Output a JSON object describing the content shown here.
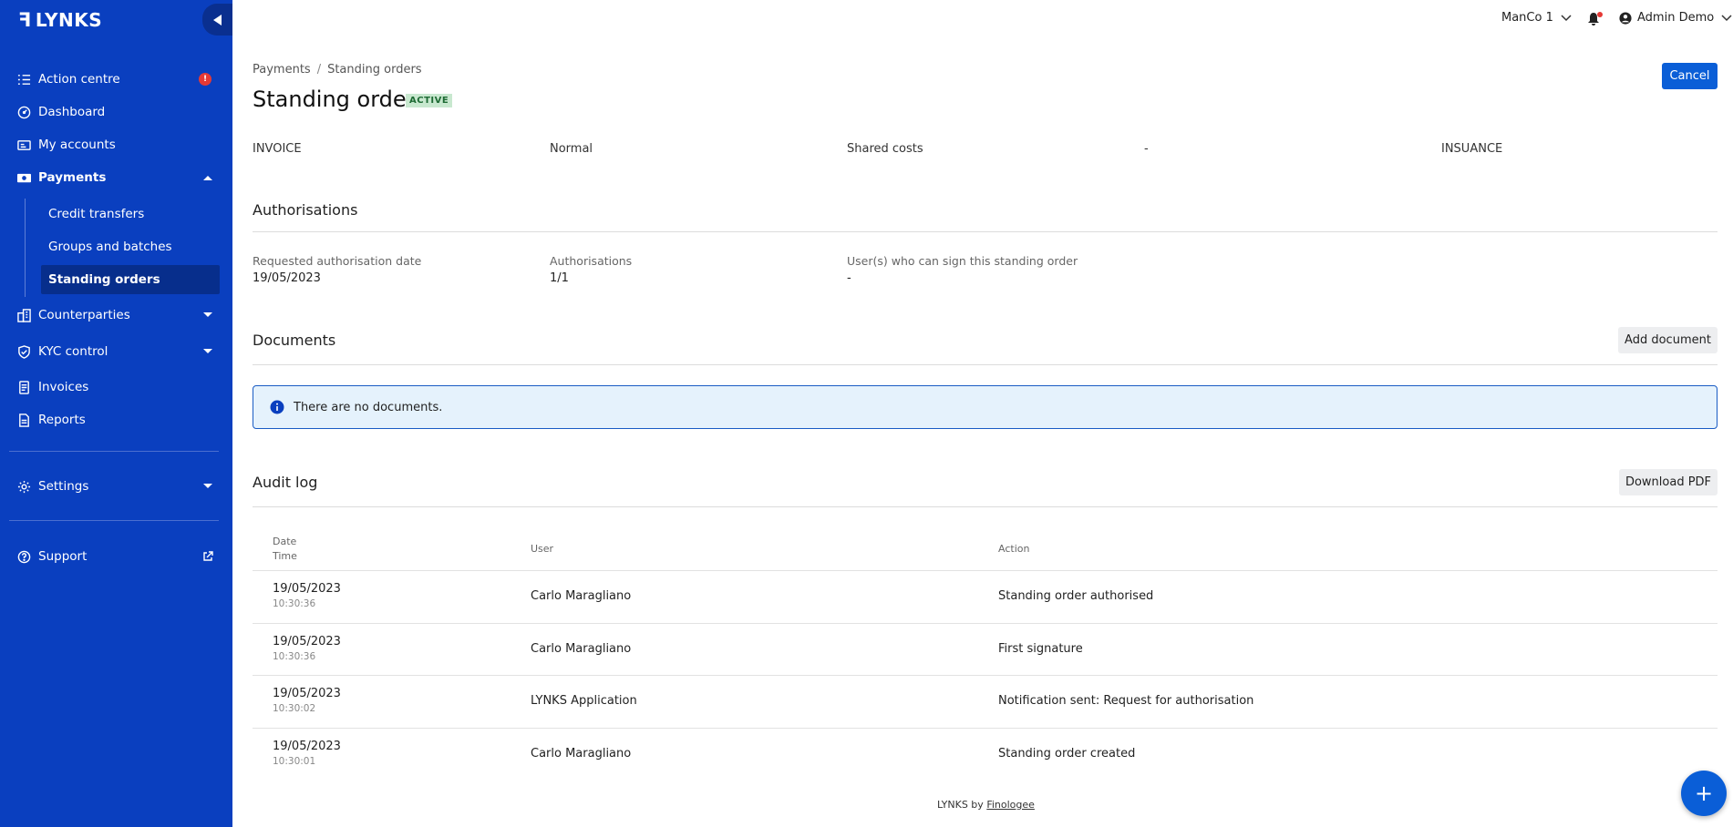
{
  "app": {
    "logo_text": "LYNKS",
    "logo_mark": "ꟻ"
  },
  "colors": {
    "sidebar": "#0a3fbf",
    "accent": "#0a5ed7",
    "alert": "#e53935",
    "active_badge_bg": "#c8e8cf"
  },
  "sidebar": {
    "items": [
      {
        "label": "Action centre",
        "icon": "checklist-icon",
        "badge": "!"
      },
      {
        "label": "Dashboard",
        "icon": "dashboard-icon"
      },
      {
        "label": "My accounts",
        "icon": "accounts-icon"
      },
      {
        "label": "Payments",
        "icon": "payments-icon"
      },
      {
        "label": "Counterparties",
        "icon": "counterparties-icon"
      },
      {
        "label": "KYC control",
        "icon": "shield-icon"
      },
      {
        "label": "Invoices",
        "icon": "invoice-icon"
      },
      {
        "label": "Reports",
        "icon": "report-icon"
      },
      {
        "label": "Settings",
        "icon": "gear-icon"
      },
      {
        "label": "Support",
        "icon": "help-icon"
      }
    ],
    "payments_sub": [
      "Credit transfers",
      "Groups and batches",
      "Standing orders"
    ]
  },
  "topbar": {
    "company": "ManCo 1",
    "user": "Admin Demo"
  },
  "breadcrumb": [
    "Payments",
    "Standing orders"
  ],
  "page": {
    "title": "Standing order",
    "status": "ACTIVE",
    "cancel_label": "Cancel"
  },
  "cut_row": [
    "INVOICE",
    "Normal",
    "Shared costs",
    "-",
    "INSUANCE"
  ],
  "authorisations": {
    "title": "Authorisations",
    "fields": [
      {
        "label": "Requested authorisation date",
        "value": "19/05/2023"
      },
      {
        "label": "Authorisations",
        "value": "1/1"
      },
      {
        "label": "User(s) who can sign this standing order",
        "value": "-"
      }
    ]
  },
  "documents": {
    "title": "Documents",
    "add_label": "Add document",
    "empty_text": "There are no documents."
  },
  "audit": {
    "title": "Audit log",
    "download_label": "Download PDF",
    "headers": {
      "date": "Date",
      "time": "Time",
      "user": "User",
      "action": "Action"
    },
    "rows": [
      {
        "date": "19/05/2023",
        "time": "10:30:36",
        "user": "Carlo Maragliano",
        "action": "Standing order authorised"
      },
      {
        "date": "19/05/2023",
        "time": "10:30:36",
        "user": "Carlo Maragliano",
        "action": "First signature"
      },
      {
        "date": "19/05/2023",
        "time": "10:30:02",
        "user": "LYNKS Application",
        "action": "Notification sent: Request for authorisation"
      },
      {
        "date": "19/05/2023",
        "time": "10:30:01",
        "user": "Carlo Maragliano",
        "action": "Standing order created"
      }
    ]
  },
  "footer": {
    "prefix": "LYNKS by",
    "link": "Finologee"
  },
  "fab_label": "+"
}
